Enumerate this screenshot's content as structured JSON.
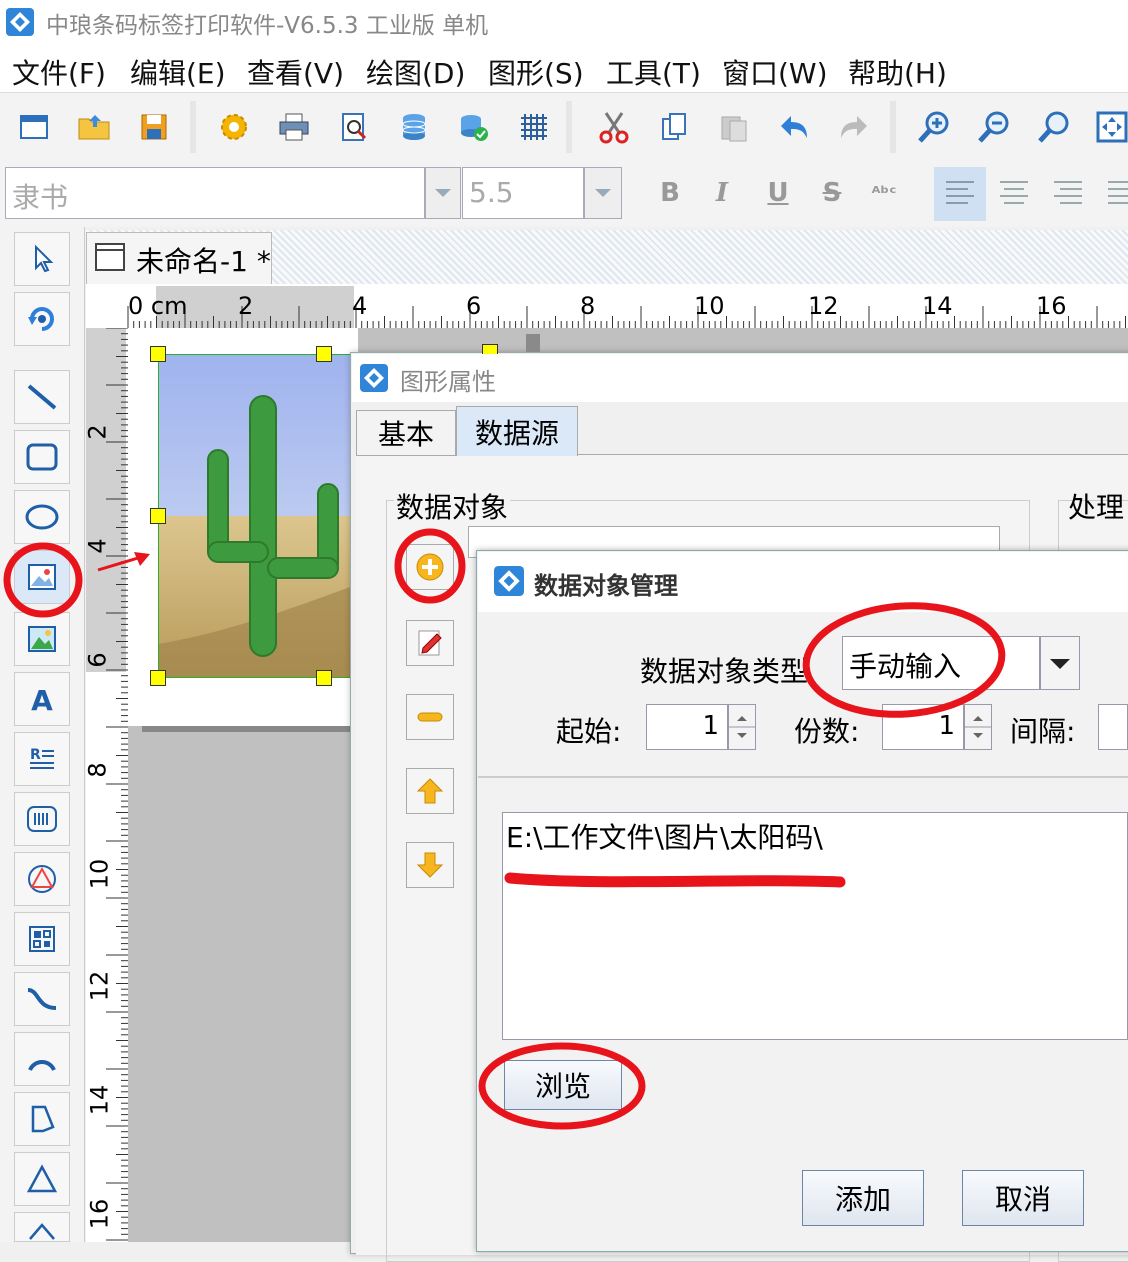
{
  "app": {
    "title": "中琅条码标签打印软件-V6.5.3 工业版 单机"
  },
  "menu": [
    {
      "label": "文件(F)"
    },
    {
      "label": "编辑(E)"
    },
    {
      "label": "查看(V)"
    },
    {
      "label": "绘图(D)"
    },
    {
      "label": "图形(S)"
    },
    {
      "label": "工具(T)"
    },
    {
      "label": "窗口(W)"
    },
    {
      "label": "帮助(H)"
    }
  ],
  "toolbar": {
    "icons": [
      "new-icon",
      "open-folder-icon",
      "save-icon",
      "settings-gear-icon",
      "print-icon",
      "print-preview-icon",
      "database-icon",
      "database-connect-icon",
      "grid-icon",
      "cut-icon",
      "copy-icon",
      "paste-icon",
      "undo-icon",
      "redo-icon",
      "zoom-in-icon",
      "zoom-out-icon",
      "zoom-icon",
      "fit-window-icon"
    ]
  },
  "format": {
    "font": "隶书",
    "size": "5.5",
    "bold": "B",
    "italic": "I",
    "underline": "U",
    "strike": "S",
    "special": "ᴬᵇᶜ"
  },
  "document": {
    "tab_label": "未命名-1 *"
  },
  "ruler": {
    "top_labels": [
      "0 cm",
      "2",
      "4",
      "6",
      "8",
      "10",
      "12",
      "14",
      "16"
    ],
    "left_labels": [
      "2",
      "4",
      "6",
      "8",
      "10",
      "12",
      "14",
      "16"
    ]
  },
  "graphic_props_dialog": {
    "title": "图形属性",
    "tabs": [
      {
        "label": "基本",
        "active": false
      },
      {
        "label": "数据源",
        "active": true
      }
    ],
    "group_title": "数据对象",
    "process_title": "处理"
  },
  "data_object_dialog": {
    "title": "数据对象管理",
    "type_label": "数据对象类型",
    "type_value": "手动输入",
    "start_label": "起始:",
    "start_value": "1",
    "copies_label": "份数:",
    "copies_value": "1",
    "interval_label": "间隔:",
    "path": "E:\\工作文件\\图片\\太阳码\\",
    "browse": "浏览",
    "add": "添加",
    "cancel": "取消"
  },
  "colors": {
    "annotation_red": "#e8141c",
    "selection_handle": "#ffff00",
    "active_tab": "#dbe8f7"
  }
}
